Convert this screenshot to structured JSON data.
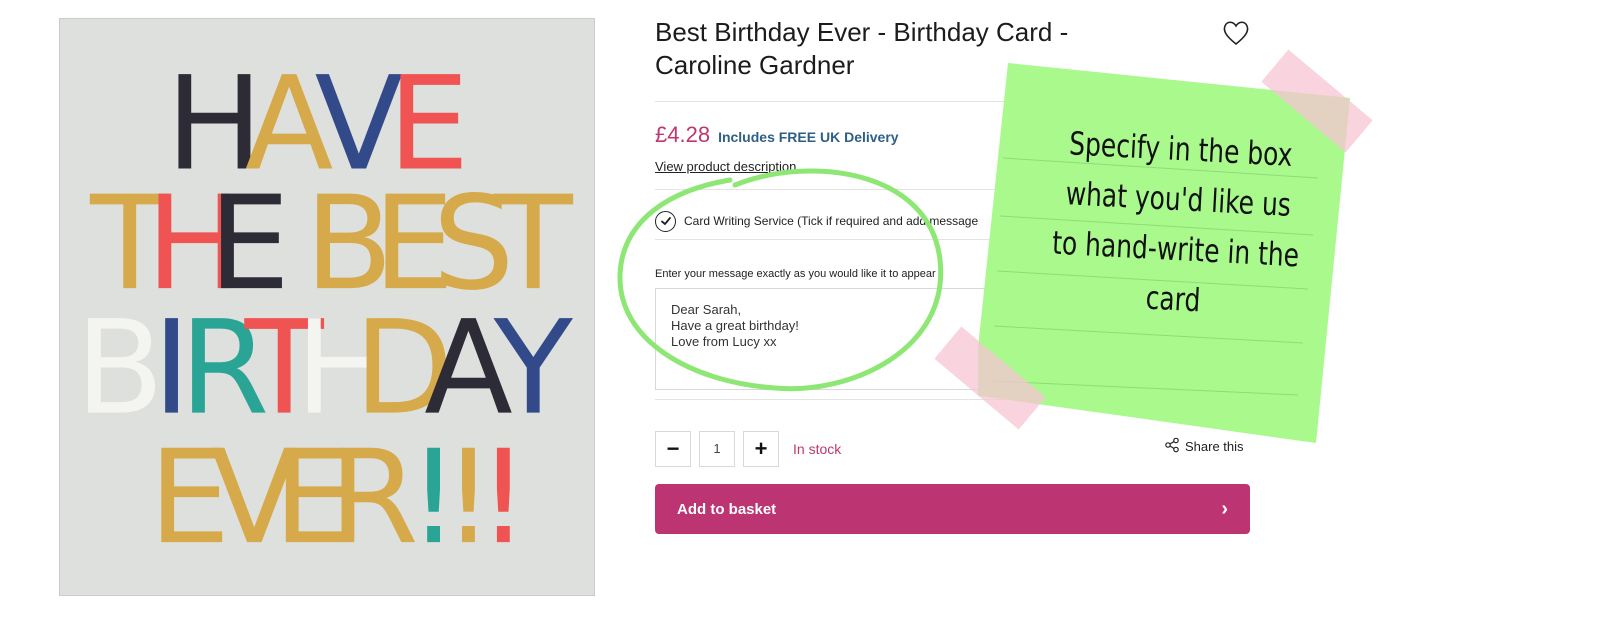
{
  "product": {
    "title": "Best Birthday Ever - Birthday Card - Caroline Gardner",
    "price": "£4.28",
    "delivery_note": "Includes FREE UK Delivery",
    "view_description": "View product description",
    "image_alt": "HAVE THE BEST BIRTHDAY EVER!!!"
  },
  "card_service": {
    "checked": true,
    "label": "Card Writing Service (Tick if required and add message"
  },
  "message": {
    "label": "Enter your message exactly as you would like it to appear",
    "value": "Dear Sarah,\nHave a great birthday!\nLove from Lucy xx"
  },
  "quantity": {
    "minus": "−",
    "value": "1",
    "plus": "+"
  },
  "stock_status": "In stock",
  "share_label": "Share this",
  "basket": {
    "label": "Add to basket",
    "chevron": "›"
  },
  "annotation": {
    "note_text": "Specify in the box what you'd like us to hand-write in the card",
    "note_color": "#a9f98d",
    "circle_color": "#8ee774"
  },
  "colors": {
    "accent": "#bd3472",
    "price": "#c0366f",
    "delivery": "#2d5f87"
  },
  "icons": {
    "wishlist": "heart-outline-icon",
    "check": "check-circle-icon",
    "share": "share-icon",
    "chevron": "chevron-right-icon"
  }
}
